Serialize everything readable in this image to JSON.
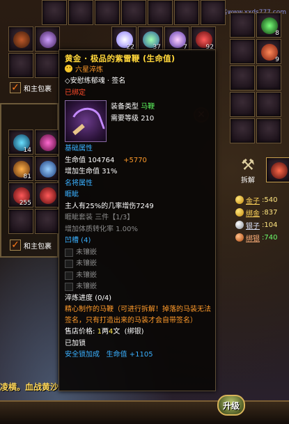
{
  "watermark": "小雪代售www.xxds777.com",
  "background": {
    "top_slots": [
      {
        "qty": ""
      },
      {
        "qty": ""
      },
      {
        "qty": ""
      },
      {
        "qty": ""
      },
      {
        "qty": ""
      },
      {
        "qty": ""
      },
      {
        "qty": ""
      }
    ],
    "row2_slots": [
      {
        "qty": ""
      },
      {
        "qty": ""
      },
      {
        "qty": "22"
      },
      {
        "qty": "37"
      },
      {
        "qty": "7"
      },
      {
        "qty": "92"
      }
    ],
    "left_slots_qty": [
      "14",
      "81",
      "255"
    ],
    "right_slots_qty": [
      "8",
      "9"
    ],
    "bind_label_1": "和主包裹",
    "bind_label_2": "和主包裹",
    "split_label": "拆解",
    "upgrade_label": "升级",
    "close_symbol": "✕",
    "bottom_ticker": "凌横。血战黄沙",
    "currency": [
      {
        "label": "金子",
        "value": ":540",
        "type": "gold"
      },
      {
        "label": "绑金",
        "value": ":837",
        "type": "gold"
      },
      {
        "label": "银子",
        "value": ":104",
        "type": "silver"
      },
      {
        "label": "绑银",
        "value": ":740",
        "type": "bound"
      }
    ]
  },
  "tooltip": {
    "title": "黄金 · 极品的紫雷鞭 (生命值)",
    "refine": "六星淬炼",
    "engrave": "◇安慰练郁魂 · 签名",
    "bound_status": "已绑定",
    "equip_type_label": "装备类型",
    "equip_type_value": "马鞭",
    "level_label": "需要等级",
    "level_value": "210",
    "base_attr_header": "基础属性",
    "hp_label": "生命值",
    "hp_value": "104764",
    "hp_bonus": "+5770",
    "hp_pct_label": "增加生命值",
    "hp_pct_value": "31%",
    "extra_attr_header": "名将属性",
    "spirit_header": "睚眦",
    "spirit_line1": "主人有25%的几率增伤7249",
    "spirit_set_label": "睚眦套装",
    "spirit_set_value": "三件【1/3】",
    "spirit_line3": "增加体质转化率 1.00%",
    "socket_header": "凹槽 (4)",
    "sockets": [
      "未镶嵌",
      "未镶嵌",
      "未镶嵌",
      "未镶嵌"
    ],
    "refine_progress_label": "淬炼进度",
    "refine_progress_value": "(0/4)",
    "desc": "精心制作的马鞭（可进行拆解！掉落的马装无法签名，只有打造出来的马装才会自带签名）",
    "shop_price_label": "售店价格:",
    "shop_price_1": "1",
    "shop_price_unit_1": "两",
    "shop_price_2": "4",
    "shop_price_unit_2": "文",
    "shop_price_bind": "(绑银)",
    "locked": "已加锁",
    "lock_bonus_label": "安全锁加成",
    "lock_bonus_stat": "生命值",
    "lock_bonus_value": "+1105"
  }
}
